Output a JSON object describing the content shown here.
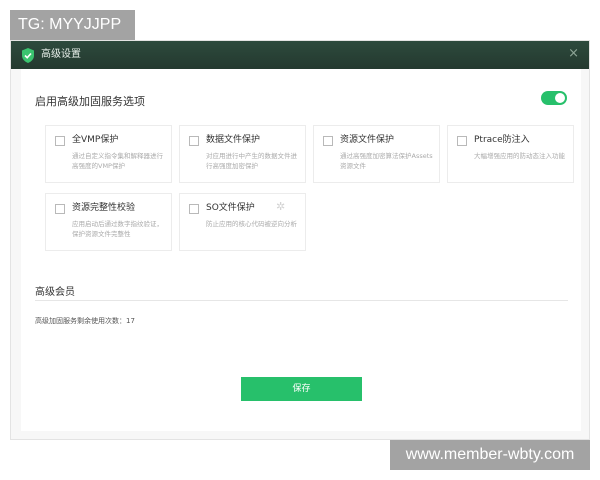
{
  "watermarks": {
    "top_left": "TG: MYYJJPP",
    "bottom_right": "www.member-wbty.com"
  },
  "dialog": {
    "title": "高级设置",
    "close_glyph": "×",
    "shield_icon_color": "#3ac46f"
  },
  "advanced": {
    "heading": "启用高级加固服务选项",
    "toggle_on": true,
    "accent_color": "#27c06b"
  },
  "cards": [
    {
      "title": "全VMP保护",
      "desc": "通过自定义指令集和解释器进行高强度的VMP保护",
      "checked": false
    },
    {
      "title": "数据文件保护",
      "desc": "对应用进行中产生的数据文件进行高强度加密保护",
      "checked": false
    },
    {
      "title": "资源文件保护",
      "desc": "通过高强度加密算法保护Assets资源文件",
      "checked": false
    },
    {
      "title": "Ptrace防注入",
      "desc": "大幅增强应用的防动态注入功能",
      "checked": false
    },
    {
      "title": "资源完整性校验",
      "desc": "应用启动后通过数字指纹验证，保护资源文件完整性",
      "checked": false
    },
    {
      "title": "SO文件保护",
      "desc": "防止应用的核心代码被逆向分析",
      "checked": false,
      "icon": "gear-icon"
    }
  ],
  "member": {
    "section_title": "高级会员",
    "usage_label": "高级加固服务剩余使用次数：",
    "usage_count": "17"
  },
  "save_label": "保存"
}
